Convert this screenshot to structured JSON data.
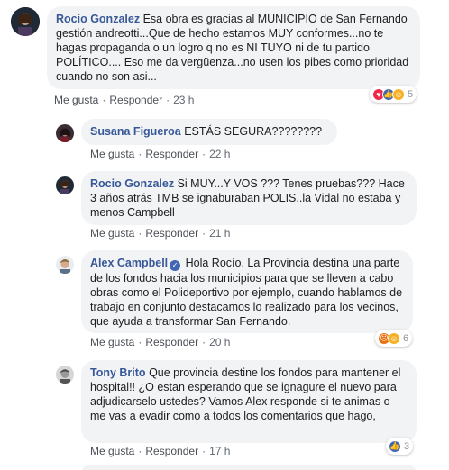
{
  "comments": [
    {
      "author": "Rocio Gonzalez",
      "text": "Esa obra es gracias al MUNICIPIO de San Fernando gestión andreotti...Que de hecho estamos MUY conformes...no te hagas propaganda o un logro q no es NI TUYO ni de tu partido POLÍTICO.... Eso me da vergüenza...no usen los pibes como prioridad cuando no son asi...",
      "like": "Me gusta",
      "reply": "Responder",
      "time": "23 h",
      "reaction_count": "5"
    },
    {
      "author": "Susana Figueroa",
      "text": "ESTÁS SEGURA????????",
      "like": "Me gusta",
      "reply": "Responder",
      "time": "22 h"
    },
    {
      "author": "Rocio Gonzalez",
      "text": "Si MUY...Y VOS ??? Tenes pruebas??? Hace 3 años atrás TMB se ignaburaban POLIS..la Vidal no estaba y menos Campbell",
      "like": "Me gusta",
      "reply": "Responder",
      "time": "21 h"
    },
    {
      "author": "Alex Campbell",
      "text": "Hola Rocío. La Provincia destina una parte de los fondos hacia los municipios para que se lleven a cabo obras como el Polideportivo por ejemplo, cuando hablamos de trabajo en conjunto destacamos lo realizado para los vecinos, que ayuda a transformar San Fernando.",
      "like": "Me gusta",
      "reply": "Responder",
      "time": "20 h",
      "reaction_count": "6"
    },
    {
      "author": "Tony Brito",
      "text": "Que provincia destine los fondos para mantener el hospital!! ¿O estan esperando que se ignagure el nuevo para adjudicarselo ustedes? Vamos Alex responde si te animas o me vas a evadir como a todos los comentarios que hago,",
      "like": "Me gusta",
      "reply": "Responder",
      "time": "17 h",
      "reaction_count": "3"
    }
  ],
  "colors": {
    "name": "#385898",
    "bubble": "#f2f3f5",
    "like": "#4267b2",
    "love": "#f0284a",
    "haha": "#f7b125",
    "angry": "#e9710f"
  },
  "icons": [
    "like-icon",
    "love-icon",
    "haha-icon",
    "angry-icon",
    "verified-badge-icon"
  ]
}
